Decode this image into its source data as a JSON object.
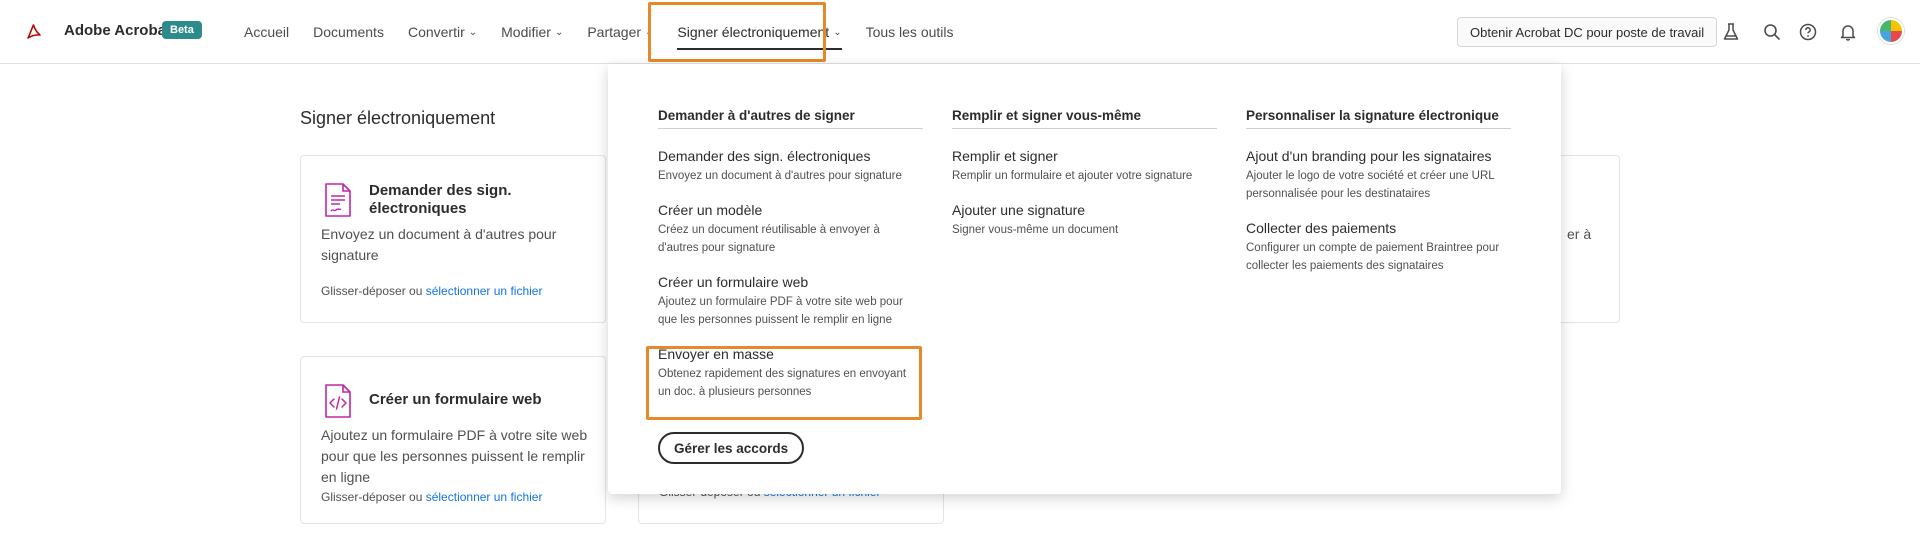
{
  "app": {
    "brand": "Adobe Acrobat",
    "badge": "Beta"
  },
  "nav": {
    "items": [
      {
        "label": "Accueil",
        "chevron": false
      },
      {
        "label": "Documents",
        "chevron": false
      },
      {
        "label": "Convertir",
        "chevron": true
      },
      {
        "label": "Modifier",
        "chevron": true
      },
      {
        "label": "Partager",
        "chevron": true
      },
      {
        "label": "Signer électroniquement",
        "chevron": true,
        "active": true
      },
      {
        "label": "Tous les outils",
        "chevron": false
      }
    ]
  },
  "toolbar": {
    "get_dc_label": "Obtenir Acrobat DC pour poste de travail",
    "icons": [
      "flask-icon",
      "search-icon",
      "help-icon",
      "bell-icon",
      "avatar"
    ]
  },
  "page": {
    "title": "Signer électroniquement",
    "cards": [
      {
        "title": "Demander des sign. électroniques",
        "desc": "Envoyez un document à d'autres pour signature",
        "foot_text": "Glisser-déposer ou ",
        "foot_link": "sélectionner un fichier"
      },
      {
        "title": "Créer un formulaire web",
        "desc": "Ajoutez un formulaire PDF à votre site web pour que les personnes puissent le remplir en ligne",
        "foot_text": "Glisser-déposer ou ",
        "foot_link": "sélectionner un fichier"
      },
      {
        "foot_text": "Glisser-déposer ou ",
        "foot_link": "sélectionner un fichier"
      }
    ],
    "partial_text": "er à"
  },
  "dropdown": {
    "columns": [
      {
        "heading": "Demander à d'autres de signer",
        "items": [
          {
            "title": "Demander des sign. électroniques",
            "desc": "Envoyez un document à d'autres pour signature"
          },
          {
            "title": "Créer un modèle",
            "desc": "Créez un document réutilisable à envoyer à d'autres pour signature"
          },
          {
            "title": "Créer un formulaire web",
            "desc": "Ajoutez un formulaire PDF à votre site web pour que les personnes puissent le remplir en ligne"
          },
          {
            "title": "Envoyer en masse",
            "desc": "Obtenez rapidement des signatures en envoyant un doc. à plusieurs personnes"
          }
        ]
      },
      {
        "heading": "Remplir et signer vous-même",
        "items": [
          {
            "title": "Remplir et signer",
            "desc": "Remplir un formulaire et ajouter votre signature"
          },
          {
            "title": "Ajouter une signature",
            "desc": "Signer vous-même un document"
          }
        ]
      },
      {
        "heading": "Personnaliser la signature électronique",
        "items": [
          {
            "title": "Ajout d'un branding pour les signataires",
            "desc": "Ajouter le logo de votre société et créer une URL personnalisée pour les destinataires"
          },
          {
            "title": "Collecter des paiements",
            "desc": "Configurer un compte de paiement Braintree pour collecter les paiements des signataires"
          }
        ]
      }
    ],
    "manage_label": "Gérer les accords"
  },
  "colors": {
    "highlight": "#e58a2c",
    "link": "#1473e6",
    "badge": "#2d8b8b",
    "acrobat_red": "#b30b00"
  }
}
